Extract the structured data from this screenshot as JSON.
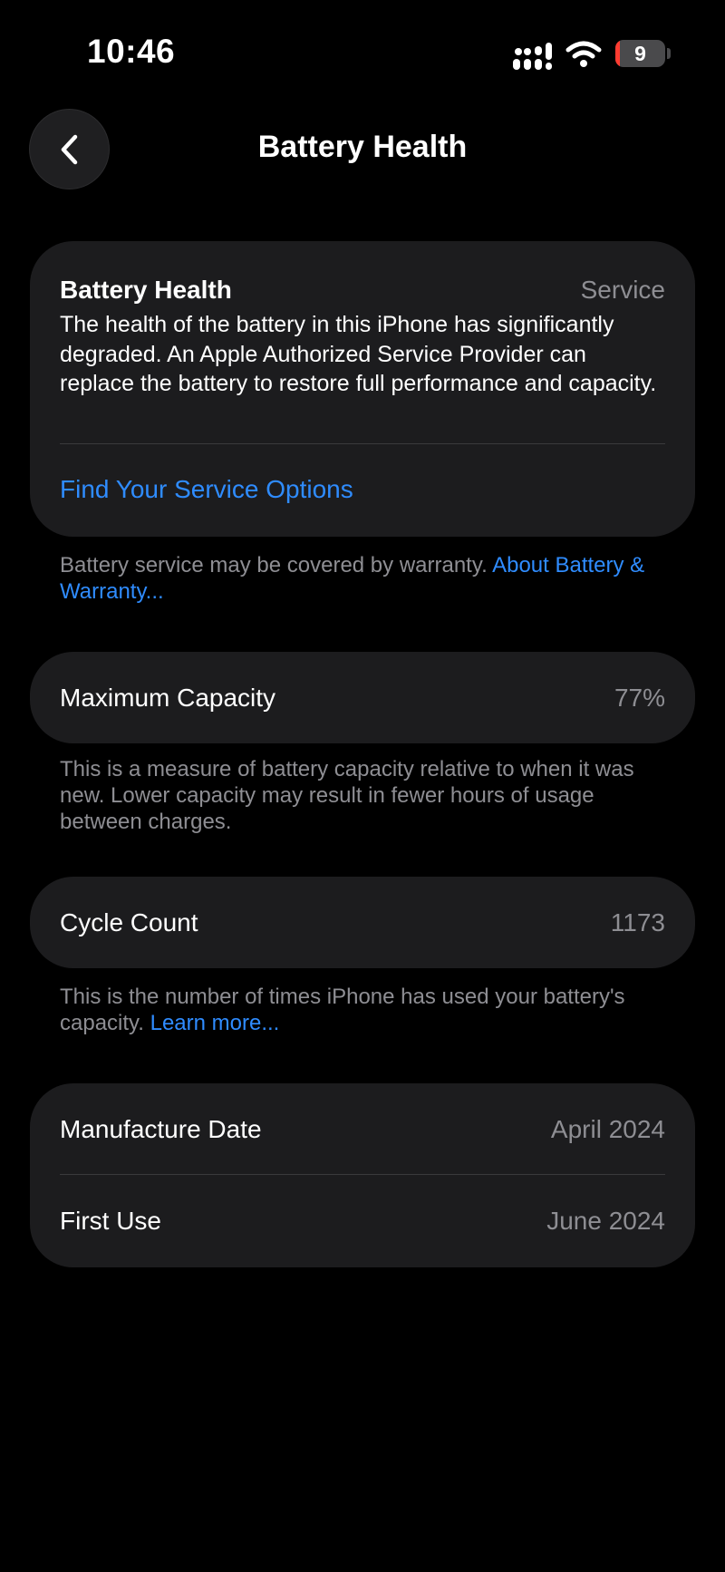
{
  "status_bar": {
    "time": "10:46",
    "battery_level": "9"
  },
  "nav": {
    "title": "Battery Health"
  },
  "battery_health_card": {
    "title": "Battery Health",
    "status": "Service",
    "description": "The health of the battery in this iPhone has significantly degraded. An Apple Authorized Service Provider can replace the battery to restore full performance and capacity.",
    "service_link": "Find Your Service Options"
  },
  "warranty_note": {
    "text": "Battery service may be covered by warranty.",
    "link": "About Battery & Warranty..."
  },
  "maximum_capacity": {
    "label": "Maximum Capacity",
    "value": "77%",
    "footnote": "This is a measure of battery capacity relative to when it was new. Lower capacity may result in fewer hours of usage between charges."
  },
  "cycle_count": {
    "label": "Cycle Count",
    "value": "1173",
    "footnote": "This is the number of times iPhone has used your battery's capacity.",
    "footnote_link": "Learn more..."
  },
  "dates": {
    "manufacture_label": "Manufacture Date",
    "manufacture_value": "April 2024",
    "first_use_label": "First Use",
    "first_use_value": "June 2024"
  },
  "colors": {
    "background": "#000000",
    "card": "#1c1c1e",
    "link": "#2f8cff",
    "secondary_text": "#8e8e93",
    "battery_low": "#ff3b30"
  },
  "icons": {
    "back": "chevron-left-icon",
    "signal": "cellular-signal-icon",
    "wifi": "wifi-icon",
    "battery": "battery-icon"
  }
}
